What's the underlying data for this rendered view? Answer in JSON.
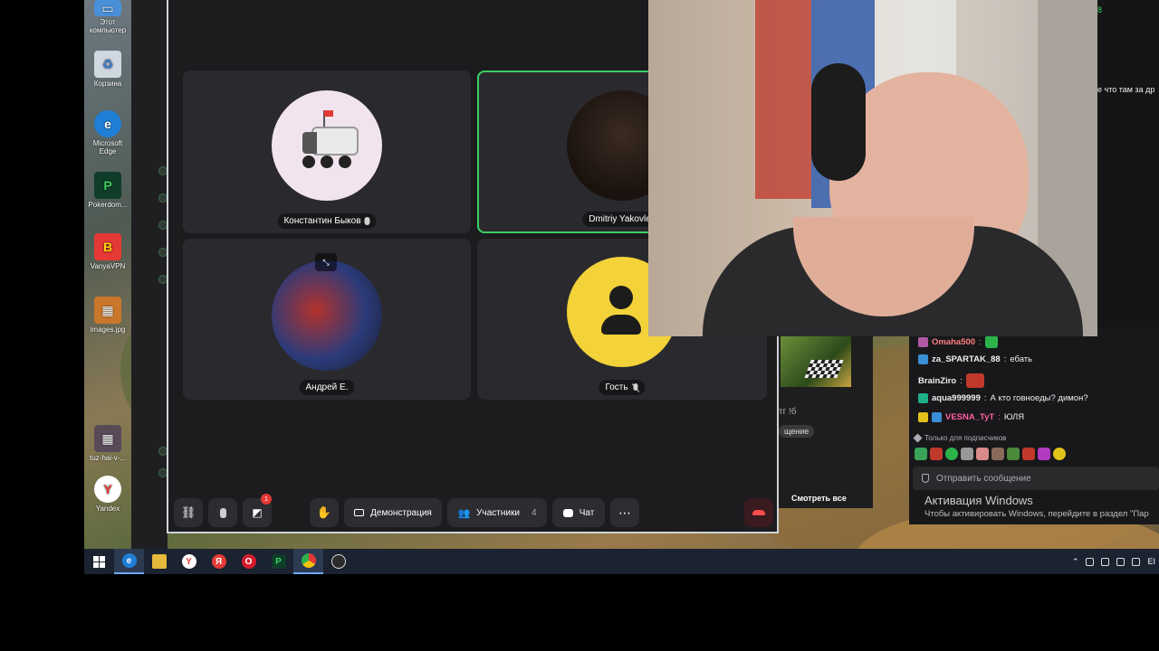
{
  "desktop": {
    "icons": [
      {
        "label": "Этот компьютер",
        "color": "#4a90d9",
        "glyph": "▭"
      },
      {
        "label": "Корзина",
        "color": "#cfd8e0",
        "glyph": "♻"
      },
      {
        "label": "Microsoft Edge",
        "color": "#1f7fd6",
        "glyph": "e"
      },
      {
        "label": "Pokerdom...",
        "color": "#0f3d2a",
        "glyph": "P"
      },
      {
        "label": "VanyaVPN",
        "color": "#e53935",
        "glyph": "B"
      },
      {
        "label": "images.jpg",
        "color": "#c9772b",
        "glyph": "▦"
      },
      {
        "label": "tuz-hai-v-...",
        "color": "#5a4a58",
        "glyph": "▦"
      },
      {
        "label": "Yandex",
        "color": "#ffffff",
        "glyph": "Y"
      }
    ]
  },
  "call": {
    "participants": [
      {
        "name": "Константин Быков",
        "mic": "on"
      },
      {
        "name": "Dmitriy Yakovlev",
        "mic": "none"
      },
      {
        "name": "Андрей Е.",
        "mic": "none"
      },
      {
        "name": "Гость",
        "mic": "muted"
      }
    ],
    "controls": {
      "link_icon": "link-icon",
      "mic_icon": "microphone-icon",
      "camera_icon": "camera-off-icon",
      "camera_badge": "1",
      "hand_icon": "raise-hand-icon",
      "demo_label": "Демонстрация",
      "participants_label": "Участники",
      "participants_count": "4",
      "chat_label": "Чат",
      "more_icon": "more-icon",
      "hangup_icon": "hangup-icon"
    }
  },
  "stream": {
    "mid_text": "тг !б",
    "mid_pill": "щение",
    "watch_all": "Смотреть все",
    "right_strip_num": "8",
    "right_strip_text": "е что там за др"
  },
  "chat": {
    "messages": [
      {
        "user": "Omaha500",
        "text": "",
        "color": "#ff7f7f",
        "badge": "#b05aa6",
        "emote": "#2bb34a"
      },
      {
        "user": "za_SPARTAK_88",
        "text": "ебать",
        "color": "#ffffff",
        "badge": "#3a8fd6",
        "emote": ""
      },
      {
        "user": "BrainZiro",
        "text": "",
        "color": "#ffffff",
        "badge": "",
        "emote": "#c0392b"
      },
      {
        "user": "aqua999999",
        "text": "А кто говноеды? димон?",
        "color": "#ffffff",
        "badge": "#1fae8a",
        "emote": ""
      },
      {
        "user": "VESNA_TyT",
        "text": "ЮЛЯ",
        "color": "#ff5fa2",
        "badge": "#e1c21b",
        "emote": ""
      }
    ],
    "subscribers_only": "Только для подписчиков",
    "input_placeholder": "Отправить сообщение"
  },
  "windows": {
    "activation_title": "Активация Windows",
    "activation_sub": "Чтобы активировать Windows, перейдите в раздел \"Пар"
  },
  "taskbar": {
    "tray_lang": "ЕI"
  }
}
